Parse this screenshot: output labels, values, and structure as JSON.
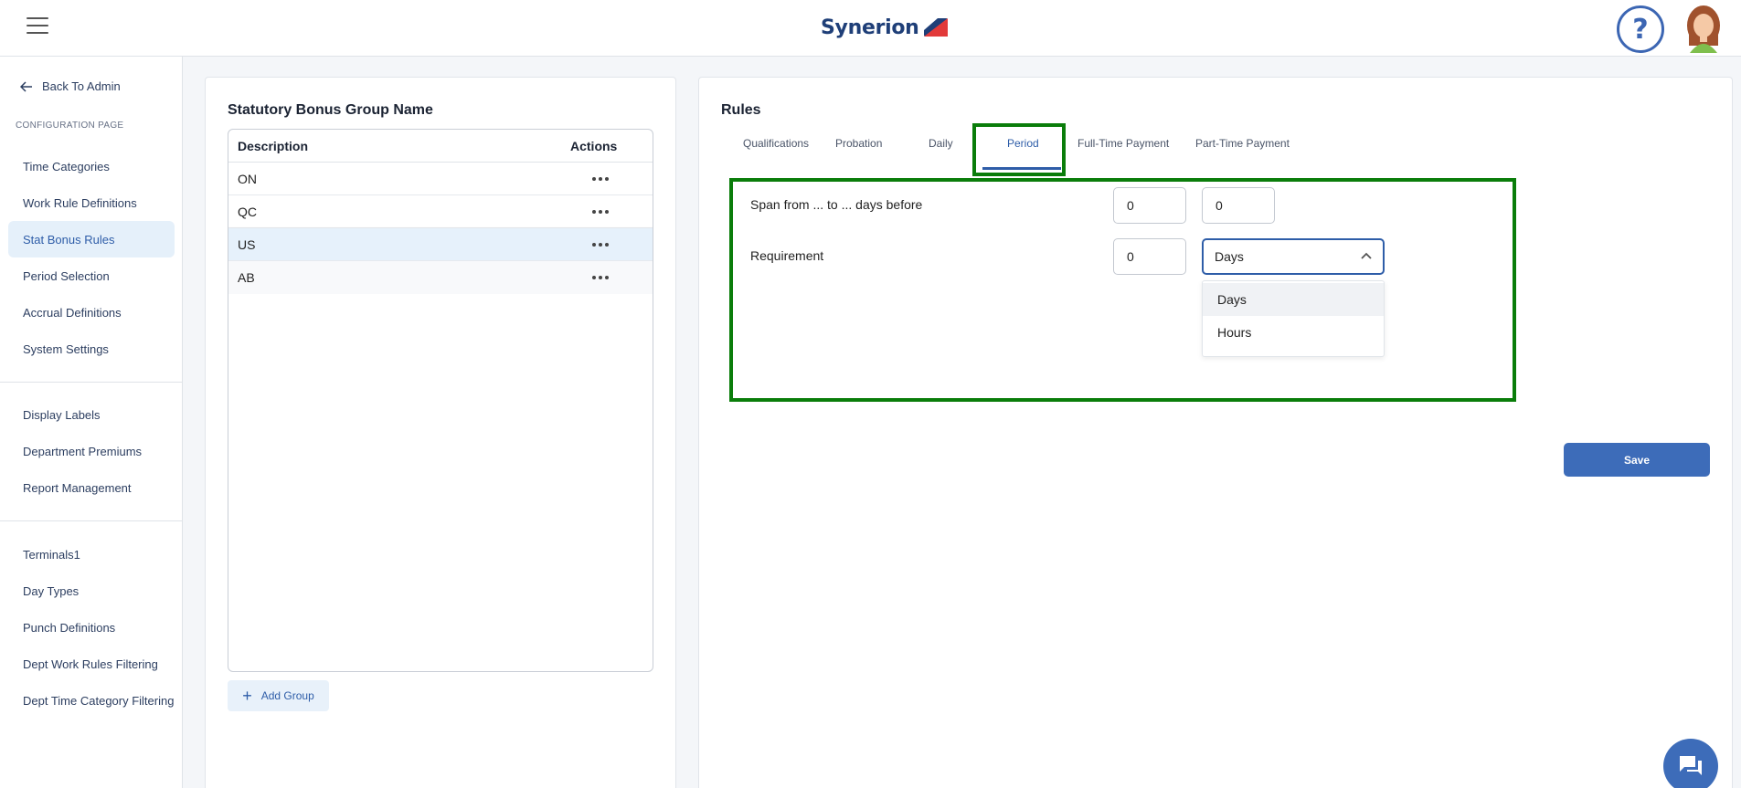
{
  "header": {
    "logo_text": "Synerion",
    "help_symbol": "?",
    "icons": {
      "menu": "hamburger-icon",
      "help": "help-icon",
      "avatar": "user-avatar"
    }
  },
  "sidebar": {
    "back_label": "Back To Admin",
    "config_label": "CONFIGURATION PAGE",
    "section1": [
      "Time Categories",
      "Work Rule Definitions",
      "Stat Bonus Rules",
      "Period Selection",
      "Accrual Definitions",
      "System Settings"
    ],
    "section2": [
      "Display Labels",
      "Department Premiums",
      "Report Management"
    ],
    "section3": [
      "Terminals1",
      "Day Types",
      "Punch Definitions",
      "Dept Work Rules Filtering",
      "Dept Time Category Filtering"
    ],
    "active_item": "Stat Bonus Rules"
  },
  "groups": {
    "title": "Statutory Bonus Group Name",
    "columns": {
      "description": "Description",
      "actions": "Actions"
    },
    "rows": [
      "ON",
      "QC",
      "US",
      "AB"
    ],
    "selected_row": "US",
    "add_label": "Add Group"
  },
  "rules": {
    "title": "Rules",
    "tabs": [
      "Qualifications",
      "Probation",
      "Daily",
      "Period",
      "Full-Time Payment",
      "Part-Time Payment"
    ],
    "active_tab": "Period",
    "span_label": "Span from ... to ... days before",
    "span_from": "0",
    "span_to": "0",
    "requirement_label": "Requirement",
    "requirement_value": "0",
    "unit_selected": "Days",
    "unit_options": [
      "Days",
      "Hours"
    ],
    "save_label": "Save"
  },
  "colors": {
    "accent": "#2e5da8",
    "highlight": "#0a7d0a",
    "button": "#3d6cb9"
  }
}
